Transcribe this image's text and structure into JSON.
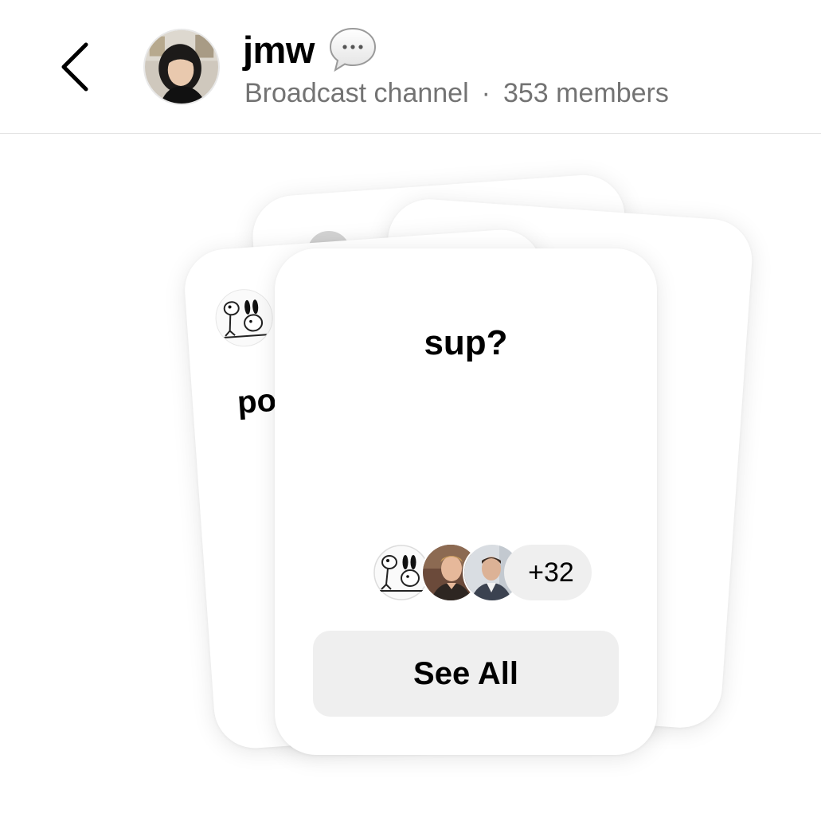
{
  "header": {
    "back_icon": "chevron-left-icon",
    "channel_name": "jmw",
    "channel_emoji_icon": "speech-bubble-icon",
    "channel_type": "Broadcast channel",
    "separator": "·",
    "members": "353 members"
  },
  "cards": {
    "left_card_text": "po",
    "front_card": {
      "prompt": "sup?",
      "extra_count": "+32",
      "see_all_label": "See All"
    }
  },
  "colors": {
    "secondary_text": "#737373",
    "pill_background": "#efefef",
    "divider": "#e3e3e3"
  }
}
